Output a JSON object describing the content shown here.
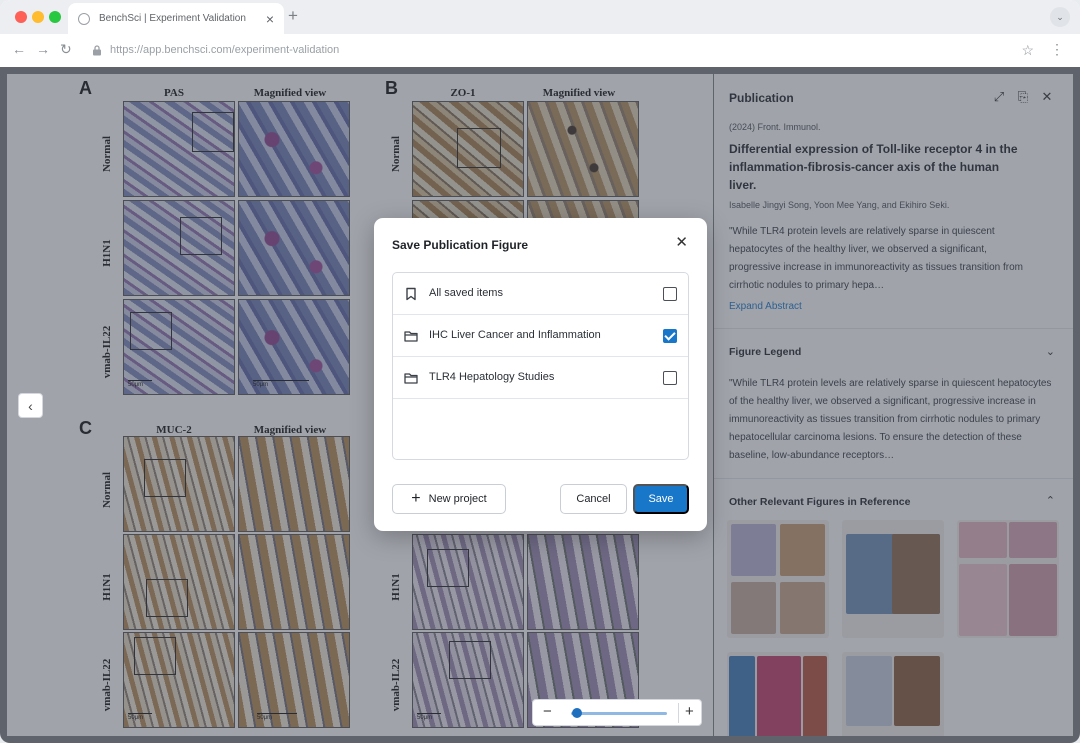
{
  "browser": {
    "tab_title": "BenchSci | Experiment Validation",
    "url": "https://app.benchsci.com/experiment-validation"
  },
  "figure": {
    "panels": [
      {
        "letter": "A",
        "columns": [
          "PAS",
          "Magnified view"
        ]
      },
      {
        "letter": "B",
        "columns": [
          "ZO-1",
          "Magnified view"
        ]
      },
      {
        "letter": "C",
        "columns": [
          "MUC-2",
          "Magnified view"
        ]
      }
    ],
    "row_labels": [
      "Normal",
      "H1N1",
      "vmab-IL22"
    ],
    "scale_label": "50μm"
  },
  "side_panel": {
    "title": "Publication",
    "meta": "(2024) Front. Immunol.",
    "pub_title": "Differential expression of Toll-like receptor 4 in the inflammation-fibrosis-cancer axis of the human liver.",
    "authors": "Isabelle Jingyi Song, Yoon Mee Yang, and Ekihiro Seki.",
    "abstract": "\"While TLR4 protein levels are relatively sparse in quiescent hepatocytes of the healthy liver, we observed a significant, progressive increase in immunoreactivity as tissues transition from cirrhotic nodules to primary hepa…",
    "expand_label": "Expand Abstract",
    "legend_title": "Figure Legend",
    "legend_text": "\"While TLR4 protein levels are relatively sparse in quiescent hepatocytes of the healthy liver, we observed a significant, progressive increase in immunoreactivity as tissues transition from cirrhotic nodules to primary hepatocellular carcinoma lesions. To ensure the detection of these baseline, low-abundance receptors…",
    "other_title": "Other Relevant Figures in Reference"
  },
  "modal": {
    "title": "Save Publication Figure",
    "items": [
      {
        "label": "All saved items",
        "icon": "bookmark-icon",
        "checked": false
      },
      {
        "label": "IHC Liver Cancer and Inflammation",
        "icon": "folder-icon",
        "checked": true
      },
      {
        "label": "TLR4 Hepatology Studies",
        "icon": "folder-icon",
        "checked": false
      }
    ],
    "new_project_label": "New project",
    "cancel_label": "Cancel",
    "save_label": "Save"
  },
  "zoom": {
    "minus": "−",
    "plus": "+",
    "level": 0.05
  },
  "colors": {
    "accent": "#1877c9",
    "overlay": "#424856"
  }
}
